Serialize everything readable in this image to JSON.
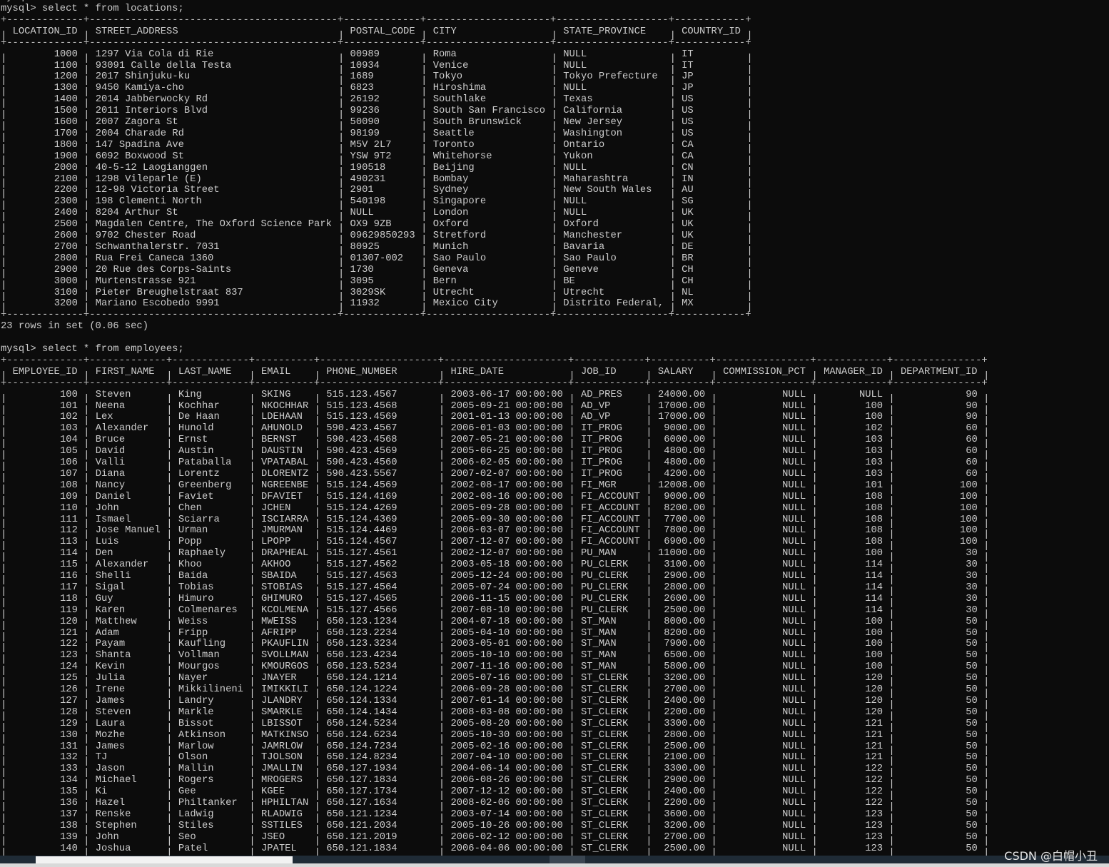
{
  "terminal": {
    "prev_prompt": "mysql>",
    "query1": "mysql> select * from locations;",
    "result1": "23 rows in set (0.06 sec)",
    "query2": "mysql> select * from employees;"
  },
  "locations": {
    "headers": [
      "LOCATION_ID",
      "STREET_ADDRESS",
      "POSTAL_CODE",
      "CITY",
      "STATE_PROVINCE",
      "COUNTRY_ID"
    ],
    "rows": [
      [
        "1000",
        "1297 Via Cola di Rie",
        "00989",
        "Roma",
        "NULL",
        "IT"
      ],
      [
        "1100",
        "93091 Calle della Testa",
        "10934",
        "Venice",
        "NULL",
        "IT"
      ],
      [
        "1200",
        "2017 Shinjuku-ku",
        "1689",
        "Tokyo",
        "Tokyo Prefecture",
        "JP"
      ],
      [
        "1300",
        "9450 Kamiya-cho",
        "6823",
        "Hiroshima",
        "NULL",
        "JP"
      ],
      [
        "1400",
        "2014 Jabberwocky Rd",
        "26192",
        "Southlake",
        "Texas",
        "US"
      ],
      [
        "1500",
        "2011 Interiors Blvd",
        "99236",
        "South San Francisco",
        "California",
        "US"
      ],
      [
        "1600",
        "2007 Zagora St",
        "50090",
        "South Brunswick",
        "New Jersey",
        "US"
      ],
      [
        "1700",
        "2004 Charade Rd",
        "98199",
        "Seattle",
        "Washington",
        "US"
      ],
      [
        "1800",
        "147 Spadina Ave",
        "M5V 2L7",
        "Toronto",
        "Ontario",
        "CA"
      ],
      [
        "1900",
        "6092 Boxwood St",
        "YSW 9T2",
        "Whitehorse",
        "Yukon",
        "CA"
      ],
      [
        "2000",
        "40-5-12 Laogianggen",
        "190518",
        "Beijing",
        "NULL",
        "CN"
      ],
      [
        "2100",
        "1298 Vileparle (E)",
        "490231",
        "Bombay",
        "Maharashtra",
        "IN"
      ],
      [
        "2200",
        "12-98 Victoria Street",
        "2901",
        "Sydney",
        "New South Wales",
        "AU"
      ],
      [
        "2300",
        "198 Clementi North",
        "540198",
        "Singapore",
        "NULL",
        "SG"
      ],
      [
        "2400",
        "8204 Arthur St",
        "NULL",
        "London",
        "NULL",
        "UK"
      ],
      [
        "2500",
        "Magdalen Centre, The Oxford Science Park",
        "OX9 9ZB",
        "Oxford",
        "Oxford",
        "UK"
      ],
      [
        "2600",
        "9702 Chester Road",
        "09629850293",
        "Stretford",
        "Manchester",
        "UK"
      ],
      [
        "2700",
        "Schwanthalerstr. 7031",
        "80925",
        "Munich",
        "Bavaria",
        "DE"
      ],
      [
        "2800",
        "Rua Frei Caneca 1360",
        "01307-002",
        "Sao Paulo",
        "Sao Paulo",
        "BR"
      ],
      [
        "2900",
        "20 Rue des Corps-Saints",
        "1730",
        "Geneva",
        "Geneve",
        "CH"
      ],
      [
        "3000",
        "Murtenstrasse 921",
        "3095",
        "Bern",
        "BE",
        "CH"
      ],
      [
        "3100",
        "Pieter Breughelstraat 837",
        "3029SK",
        "Utrecht",
        "Utrecht",
        "NL"
      ],
      [
        "3200",
        "Mariano Escobedo 9991",
        "11932",
        "Mexico City",
        "Distrito Federal,",
        "MX"
      ]
    ]
  },
  "employees": {
    "headers": [
      "EMPLOYEE_ID",
      "FIRST_NAME",
      "LAST_NAME",
      "EMAIL",
      "PHONE_NUMBER",
      "HIRE_DATE",
      "JOB_ID",
      "SALARY",
      "COMMISSION_PCT",
      "MANAGER_ID",
      "DEPARTMENT_ID"
    ],
    "rows": [
      [
        "100",
        "Steven",
        "King",
        "SKING",
        "515.123.4567",
        "2003-06-17 00:00:00",
        "AD_PRES",
        "24000.00",
        "NULL",
        "NULL",
        "90"
      ],
      [
        "101",
        "Neena",
        "Kochhar",
        "NKOCHHAR",
        "515.123.4568",
        "2005-09-21 00:00:00",
        "AD_VP",
        "17000.00",
        "NULL",
        "100",
        "90"
      ],
      [
        "102",
        "Lex",
        "De Haan",
        "LDEHAAN",
        "515.123.4569",
        "2001-01-13 00:00:00",
        "AD_VP",
        "17000.00",
        "NULL",
        "100",
        "90"
      ],
      [
        "103",
        "Alexander",
        "Hunold",
        "AHUNOLD",
        "590.423.4567",
        "2006-01-03 00:00:00",
        "IT_PROG",
        "9000.00",
        "NULL",
        "102",
        "60"
      ],
      [
        "104",
        "Bruce",
        "Ernst",
        "BERNST",
        "590.423.4568",
        "2007-05-21 00:00:00",
        "IT_PROG",
        "6000.00",
        "NULL",
        "103",
        "60"
      ],
      [
        "105",
        "David",
        "Austin",
        "DAUSTIN",
        "590.423.4569",
        "2005-06-25 00:00:00",
        "IT_PROG",
        "4800.00",
        "NULL",
        "103",
        "60"
      ],
      [
        "106",
        "Valli",
        "Pataballa",
        "VPATABAL",
        "590.423.4560",
        "2006-02-05 00:00:00",
        "IT_PROG",
        "4800.00",
        "NULL",
        "103",
        "60"
      ],
      [
        "107",
        "Diana",
        "Lorentz",
        "DLORENTZ",
        "590.423.5567",
        "2007-02-07 00:00:00",
        "IT_PROG",
        "4200.00",
        "NULL",
        "103",
        "60"
      ],
      [
        "108",
        "Nancy",
        "Greenberg",
        "NGREENBE",
        "515.124.4569",
        "2002-08-17 00:00:00",
        "FI_MGR",
        "12008.00",
        "NULL",
        "101",
        "100"
      ],
      [
        "109",
        "Daniel",
        "Faviet",
        "DFAVIET",
        "515.124.4169",
        "2002-08-16 00:00:00",
        "FI_ACCOUNT",
        "9000.00",
        "NULL",
        "108",
        "100"
      ],
      [
        "110",
        "John",
        "Chen",
        "JCHEN",
        "515.124.4269",
        "2005-09-28 00:00:00",
        "FI_ACCOUNT",
        "8200.00",
        "NULL",
        "108",
        "100"
      ],
      [
        "111",
        "Ismael",
        "Sciarra",
        "ISCIARRA",
        "515.124.4369",
        "2005-09-30 00:00:00",
        "FI_ACCOUNT",
        "7700.00",
        "NULL",
        "108",
        "100"
      ],
      [
        "112",
        "Jose Manuel",
        "Urman",
        "JMURMAN",
        "515.124.4469",
        "2006-03-07 00:00:00",
        "FI_ACCOUNT",
        "7800.00",
        "NULL",
        "108",
        "100"
      ],
      [
        "113",
        "Luis",
        "Popp",
        "LPOPP",
        "515.124.4567",
        "2007-12-07 00:00:00",
        "FI_ACCOUNT",
        "6900.00",
        "NULL",
        "108",
        "100"
      ],
      [
        "114",
        "Den",
        "Raphaely",
        "DRAPHEAL",
        "515.127.4561",
        "2002-12-07 00:00:00",
        "PU_MAN",
        "11000.00",
        "NULL",
        "100",
        "30"
      ],
      [
        "115",
        "Alexander",
        "Khoo",
        "AKHOO",
        "515.127.4562",
        "2003-05-18 00:00:00",
        "PU_CLERK",
        "3100.00",
        "NULL",
        "114",
        "30"
      ],
      [
        "116",
        "Shelli",
        "Baida",
        "SBAIDA",
        "515.127.4563",
        "2005-12-24 00:00:00",
        "PU_CLERK",
        "2900.00",
        "NULL",
        "114",
        "30"
      ],
      [
        "117",
        "Sigal",
        "Tobias",
        "STOBIAS",
        "515.127.4564",
        "2005-07-24 00:00:00",
        "PU_CLERK",
        "2800.00",
        "NULL",
        "114",
        "30"
      ],
      [
        "118",
        "Guy",
        "Himuro",
        "GHIMURO",
        "515.127.4565",
        "2006-11-15 00:00:00",
        "PU_CLERK",
        "2600.00",
        "NULL",
        "114",
        "30"
      ],
      [
        "119",
        "Karen",
        "Colmenares",
        "KCOLMENA",
        "515.127.4566",
        "2007-08-10 00:00:00",
        "PU_CLERK",
        "2500.00",
        "NULL",
        "114",
        "30"
      ],
      [
        "120",
        "Matthew",
        "Weiss",
        "MWEISS",
        "650.123.1234",
        "2004-07-18 00:00:00",
        "ST_MAN",
        "8000.00",
        "NULL",
        "100",
        "50"
      ],
      [
        "121",
        "Adam",
        "Fripp",
        "AFRIPP",
        "650.123.2234",
        "2005-04-10 00:00:00",
        "ST_MAN",
        "8200.00",
        "NULL",
        "100",
        "50"
      ],
      [
        "122",
        "Payam",
        "Kaufling",
        "PKAUFLIN",
        "650.123.3234",
        "2003-05-01 00:00:00",
        "ST_MAN",
        "7900.00",
        "NULL",
        "100",
        "50"
      ],
      [
        "123",
        "Shanta",
        "Vollman",
        "SVOLLMAN",
        "650.123.4234",
        "2005-10-10 00:00:00",
        "ST_MAN",
        "6500.00",
        "NULL",
        "100",
        "50"
      ],
      [
        "124",
        "Kevin",
        "Mourgos",
        "KMOURGOS",
        "650.123.5234",
        "2007-11-16 00:00:00",
        "ST_MAN",
        "5800.00",
        "NULL",
        "100",
        "50"
      ],
      [
        "125",
        "Julia",
        "Nayer",
        "JNAYER",
        "650.124.1214",
        "2005-07-16 00:00:00",
        "ST_CLERK",
        "3200.00",
        "NULL",
        "120",
        "50"
      ],
      [
        "126",
        "Irene",
        "Mikkilineni",
        "IMIKKILI",
        "650.124.1224",
        "2006-09-28 00:00:00",
        "ST_CLERK",
        "2700.00",
        "NULL",
        "120",
        "50"
      ],
      [
        "127",
        "James",
        "Landry",
        "JLANDRY",
        "650.124.1334",
        "2007-01-14 00:00:00",
        "ST_CLERK",
        "2400.00",
        "NULL",
        "120",
        "50"
      ],
      [
        "128",
        "Steven",
        "Markle",
        "SMARKLE",
        "650.124.1434",
        "2008-03-08 00:00:00",
        "ST_CLERK",
        "2200.00",
        "NULL",
        "120",
        "50"
      ],
      [
        "129",
        "Laura",
        "Bissot",
        "LBISSOT",
        "650.124.5234",
        "2005-08-20 00:00:00",
        "ST_CLERK",
        "3300.00",
        "NULL",
        "121",
        "50"
      ],
      [
        "130",
        "Mozhe",
        "Atkinson",
        "MATKINSO",
        "650.124.6234",
        "2005-10-30 00:00:00",
        "ST_CLERK",
        "2800.00",
        "NULL",
        "121",
        "50"
      ],
      [
        "131",
        "James",
        "Marlow",
        "JAMRLOW",
        "650.124.7234",
        "2005-02-16 00:00:00",
        "ST_CLERK",
        "2500.00",
        "NULL",
        "121",
        "50"
      ],
      [
        "132",
        "TJ",
        "Olson",
        "TJOLSON",
        "650.124.8234",
        "2007-04-10 00:00:00",
        "ST_CLERK",
        "2100.00",
        "NULL",
        "121",
        "50"
      ],
      [
        "133",
        "Jason",
        "Mallin",
        "JMALLIN",
        "650.127.1934",
        "2004-06-14 00:00:00",
        "ST_CLERK",
        "3300.00",
        "NULL",
        "122",
        "50"
      ],
      [
        "134",
        "Michael",
        "Rogers",
        "MROGERS",
        "650.127.1834",
        "2006-08-26 00:00:00",
        "ST_CLERK",
        "2900.00",
        "NULL",
        "122",
        "50"
      ],
      [
        "135",
        "Ki",
        "Gee",
        "KGEE",
        "650.127.1734",
        "2007-12-12 00:00:00",
        "ST_CLERK",
        "2400.00",
        "NULL",
        "122",
        "50"
      ],
      [
        "136",
        "Hazel",
        "Philtanker",
        "HPHILTAN",
        "650.127.1634",
        "2008-02-06 00:00:00",
        "ST_CLERK",
        "2200.00",
        "NULL",
        "122",
        "50"
      ],
      [
        "137",
        "Renske",
        "Ladwig",
        "RLADWIG",
        "650.121.1234",
        "2003-07-14 00:00:00",
        "ST_CLERK",
        "3600.00",
        "NULL",
        "123",
        "50"
      ],
      [
        "138",
        "Stephen",
        "Stiles",
        "SSTILES",
        "650.121.2034",
        "2005-10-26 00:00:00",
        "ST_CLERK",
        "3200.00",
        "NULL",
        "123",
        "50"
      ],
      [
        "139",
        "John",
        "Seo",
        "JSEO",
        "650.121.2019",
        "2006-02-12 00:00:00",
        "ST_CLERK",
        "2700.00",
        "NULL",
        "123",
        "50"
      ],
      [
        "140",
        "Joshua",
        "Patel",
        "JPATEL",
        "650.121.1834",
        "2006-04-06 00:00:00",
        "ST_CLERK",
        "2500.00",
        "NULL",
        "123",
        "50"
      ]
    ]
  },
  "watermark": "CSDN @白帽小丑",
  "colors": {
    "background": "#0c0c0c",
    "text": "#cccccc",
    "taskbar": "#1f2b36"
  }
}
